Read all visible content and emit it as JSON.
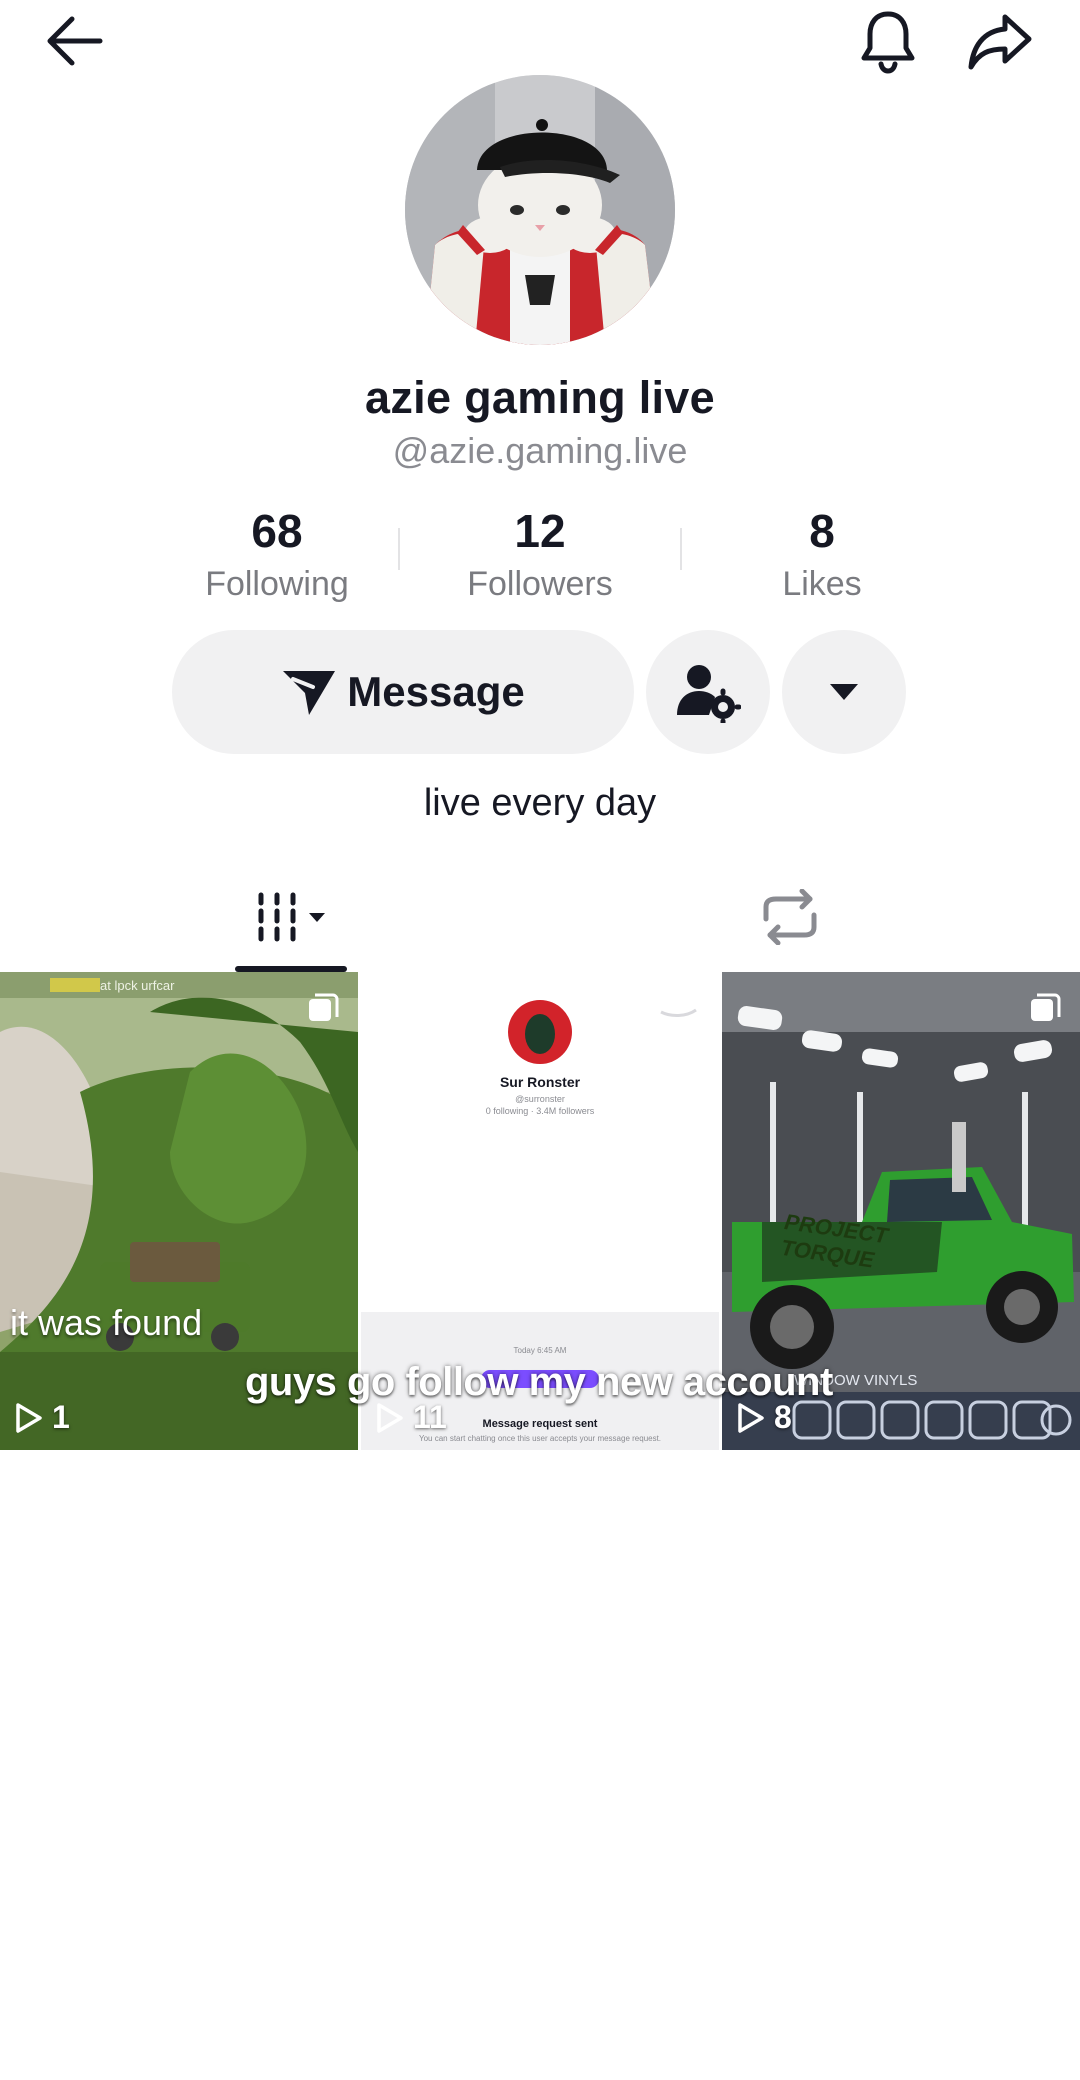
{
  "header": {
    "back_icon": "arrow-left-icon",
    "bell_icon": "bell-icon",
    "share_icon": "share-arrow-icon"
  },
  "profile": {
    "display_name": "azie gaming live",
    "handle": "@azie.gaming.live",
    "bio": "live every day",
    "avatar_icon": "cat-in-cap-avatar"
  },
  "stats": {
    "following": {
      "value": "68",
      "label": "Following"
    },
    "followers": {
      "value": "12",
      "label": "Followers"
    },
    "likes": {
      "value": "8",
      "label": "Likes"
    }
  },
  "actions": {
    "message_label": "Message",
    "message_icon": "send-plane-icon",
    "friend_settings_icon": "user-gear-icon",
    "more_icon": "caret-down-icon"
  },
  "tabs": [
    {
      "name": "videos",
      "icon": "grid-bars-icon",
      "active": true
    },
    {
      "name": "reposts",
      "icon": "repost-icon",
      "active": false
    }
  ],
  "videos": [
    {
      "views": "1",
      "caption": "it was found",
      "header_text": "at lpck urfcar",
      "pinned": true
    },
    {
      "views": "11",
      "pinned": false,
      "screen": {
        "name": "Sur Ronster",
        "handle": "@surronster",
        "counts": "0 following · 3.4M followers",
        "time": "Today 6:45 AM",
        "status": "Message request sent",
        "note": "You can start chatting once this user accepts your message request."
      }
    },
    {
      "views": "8",
      "pinned": true,
      "decal_text": "PROJECT TORQUE",
      "menu_text": "WINDOW VINYLS"
    }
  ],
  "overlay_caption": "guys go follow my new account",
  "colors": {
    "text": "#161823",
    "secondary": "#8a8b91",
    "button_bg": "#f1f1f2",
    "accent_purple": "#7b4dff",
    "truck_green": "#2f9e2f"
  }
}
